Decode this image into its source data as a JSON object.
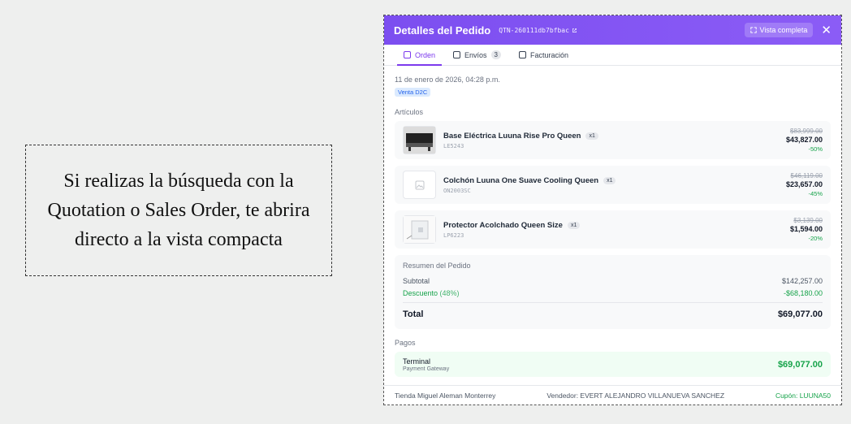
{
  "callout": {
    "text": "Si realizas la búsqueda con la Quotation o Sales Order, te abrira directo a la vista compacta"
  },
  "panel": {
    "title": "Detalles del Pedido",
    "code": "QTN-260111db7bfbac",
    "view_button": "Vista completa",
    "tabs": [
      {
        "label": "Orden",
        "icon": "clipboard-icon"
      },
      {
        "label": "Envíos",
        "icon": "truck-icon",
        "count": "3"
      },
      {
        "label": "Facturación",
        "icon": "document-icon"
      }
    ],
    "date": "11 de enero de 2026, 04:28 p.m.",
    "tag": "Venta D2C",
    "articles_label": "Artículos",
    "items": [
      {
        "name": "Base Eléctrica Luuna Rise Pro Queen",
        "qty": "x1",
        "sku": "LE5243",
        "old_price": "$83,999.00",
        "price": "$43,827.00",
        "discount": "-50%"
      },
      {
        "name": "Colchón Luuna One Suave Cooling Queen",
        "qty": "x1",
        "sku": "ON2003SC",
        "old_price": "$46,119.00",
        "price": "$23,657.00",
        "discount": "-45%"
      },
      {
        "name": "Protector Acolchado Queen Size",
        "qty": "x1",
        "sku": "LP6223",
        "old_price": "$3,139.00",
        "price": "$1,594.00",
        "discount": "-20%"
      }
    ],
    "summary": {
      "title": "Resumen del Pedido",
      "subtotal_label": "Subtotal",
      "subtotal": "$142,257.00",
      "discount_label": "Descuento",
      "discount_pct": "(48%)",
      "discount": "-$68,180.00",
      "total_label": "Total",
      "total": "$69,077.00"
    },
    "payments_label": "Pagos",
    "payment": {
      "name": "Terminal",
      "sub": "Payment Gateway",
      "amount": "$69,077.00"
    },
    "footer": {
      "store": "Tienda Miguel Aleman Monterrey",
      "seller": "Vendedor: EVERT ALEJANDRO VILLANUEVA SANCHEZ",
      "coupon": "Cupón: LUUNA50"
    },
    "colors": {
      "accent": "#7c4ef0",
      "green": "#16a34a"
    }
  }
}
